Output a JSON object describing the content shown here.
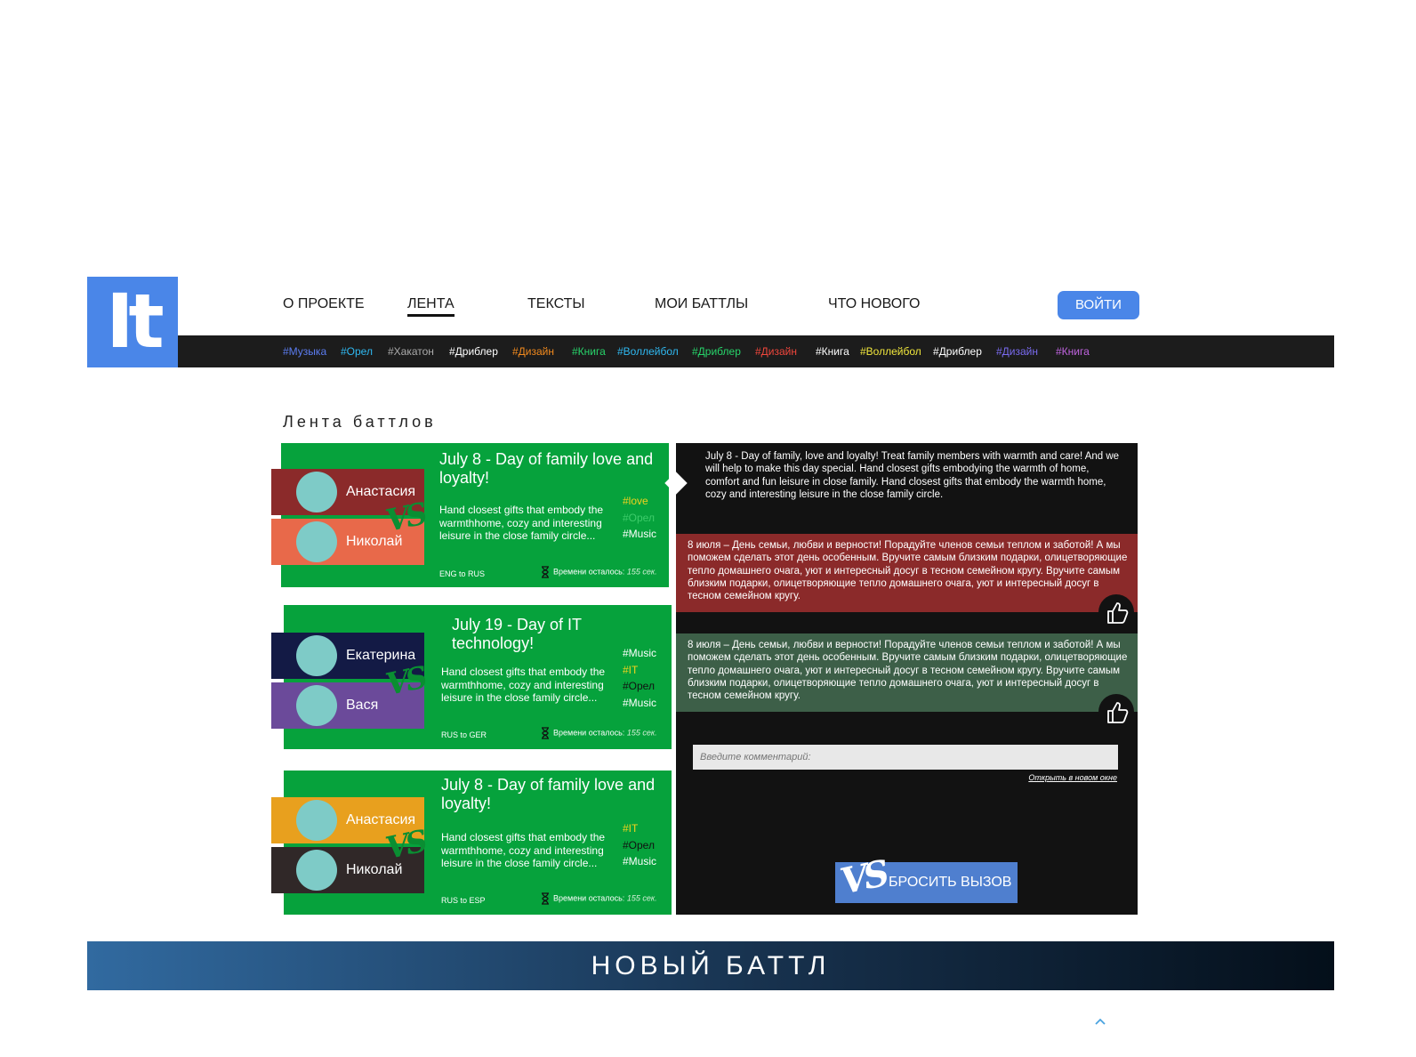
{
  "logo": {
    "text": "It"
  },
  "nav": {
    "items": [
      {
        "label": "О ПРОЕКТЕ"
      },
      {
        "label": "ЛЕНТА"
      },
      {
        "label": "ТЕКСТЫ"
      },
      {
        "label": "МОИ БАТТЛЫ"
      },
      {
        "label": "ЧТО НОВОГО"
      }
    ],
    "login": "ВОЙТИ"
  },
  "tags": [
    {
      "text": "#Музыка",
      "color": "#5b7cf0"
    },
    {
      "text": "#Орел",
      "color": "#2fb8f0"
    },
    {
      "text": "#Хакатон",
      "color": "#aaaaaa"
    },
    {
      "text": "#Дриблер",
      "color": "#ffffff"
    },
    {
      "text": "#Дизайн",
      "color": "#f28a1e"
    },
    {
      "text": "#Книга",
      "color": "#27d46a"
    },
    {
      "text": "#Воллейбол",
      "color": "#2fb8f0"
    },
    {
      "text": "#Дриблер",
      "color": "#27d46a"
    },
    {
      "text": "#Дизайн",
      "color": "#f0463c"
    },
    {
      "text": "#Книга",
      "color": "#ffffff"
    },
    {
      "text": "#Воллейбол",
      "color": "#f0e63c"
    },
    {
      "text": "#Дриблер",
      "color": "#ffffff"
    },
    {
      "text": "#Дизайн",
      "color": "#7a6bf0"
    },
    {
      "text": "#Книга",
      "color": "#c064e0"
    }
  ],
  "feed_title": "Лента баттлов",
  "battles": [
    {
      "title": "July 8 - Day of family love and loyalty!",
      "description": "Hand closest gifts that embody the warmthhome, cozy and interesting leisure in the close family circle...",
      "tags": [
        {
          "text": "#love",
          "color": "#f0d21e"
        },
        {
          "text": "#Орел",
          "color": "#3dcc6a"
        },
        {
          "text": "#Music",
          "color": "#ffffff"
        }
      ],
      "lang": "ENG to RUS",
      "timer_label": "Времени осталось:",
      "timer_value": "155 сек.",
      "player1": {
        "name": "Анастасия",
        "color": "#8b2a2a"
      },
      "player2": {
        "name": "Николай",
        "color": "#e8694a"
      },
      "vs": "VS"
    },
    {
      "title": "July 19 - Day of IT technology!",
      "description": "Hand closest gifts that embody the warmthhome, cozy and interesting leisure in the close family circle...",
      "tags": [
        {
          "text": "#Music",
          "color": "#ffffff"
        },
        {
          "text": "#IT",
          "color": "#f0d21e"
        },
        {
          "text": "#Орел",
          "color": "#111111"
        },
        {
          "text": "#Music",
          "color": "#ffffff"
        }
      ],
      "lang": "RUS to GER",
      "timer_label": "Времени осталось:",
      "timer_value": "155 сек.",
      "player1": {
        "name": "Екатерина",
        "color": "#131a45"
      },
      "player2": {
        "name": "Вася",
        "color": "#6b4a9a"
      },
      "vs": "VS"
    },
    {
      "title": "July 8 - Day of family love and loyalty!",
      "description": "Hand closest gifts that embody the warmthhome, cozy and interesting leisure in the close family circle...",
      "tags": [
        {
          "text": "#IT",
          "color": "#f0d21e"
        },
        {
          "text": "#Орел",
          "color": "#111111"
        },
        {
          "text": "#Music",
          "color": "#ffffff"
        }
      ],
      "lang": "RUS to ESP",
      "timer_label": "Времени осталось:",
      "timer_value": "155 сек.",
      "player1": {
        "name": "Анастасия",
        "color": "#e8a01e"
      },
      "player2": {
        "name": "Николай",
        "color": "#302828"
      },
      "vs": "VS"
    }
  ],
  "detail": {
    "original": "July 8 - Day of family, love and loyalty! Treat family members with warmth and care! And we will help to make this day special. Hand closest gifts embodying the warmth of home, comfort and fun leisure in close family. Hand closest gifts that embody the warmth home, cozy and interesting leisure in the close family circle.",
    "translations": [
      {
        "text": "8 июля – День семьи, любви и верности! Порадуйте членов семьи теплом и заботой! А мы поможем сделать этот день особенным. Вручите самым близким подарки, олицетворяющие тепло домашнего очага, уют и интересный досуг в тесном семейном кругу. Вручите самым близким подарки, олицетворяющие тепло домашнего очага, уют и интересный досуг в тесном семейном кругу.",
        "color": "#8b2a2a"
      },
      {
        "text": "8 июля – День семьи, любви и верности! Порадуйте членов семьи теплом и заботой! А мы поможем сделать этот день особенным. Вручите самым близким подарки, олицетворяющие тепло домашнего очага, уют и интересный досуг в тесном семейном кругу. Вручите самым близким подарки, олицетворяющие тепло домашнего очага, уют и интересный досуг в тесном семейном кругу.",
        "color": "#3d5f48"
      }
    ],
    "comment_placeholder": "Введите комментарий:",
    "open_new_window": "Открыть в новом окне",
    "challenge_label": "БРОСИТЬ ВЫЗОВ",
    "challenge_vs": "VS"
  },
  "banner": "НОВЫЙ БАТТЛ",
  "icons": {
    "like": "thumbs-up-icon",
    "timer": "hourglass-icon",
    "to_top": "chevron-up-icon"
  }
}
